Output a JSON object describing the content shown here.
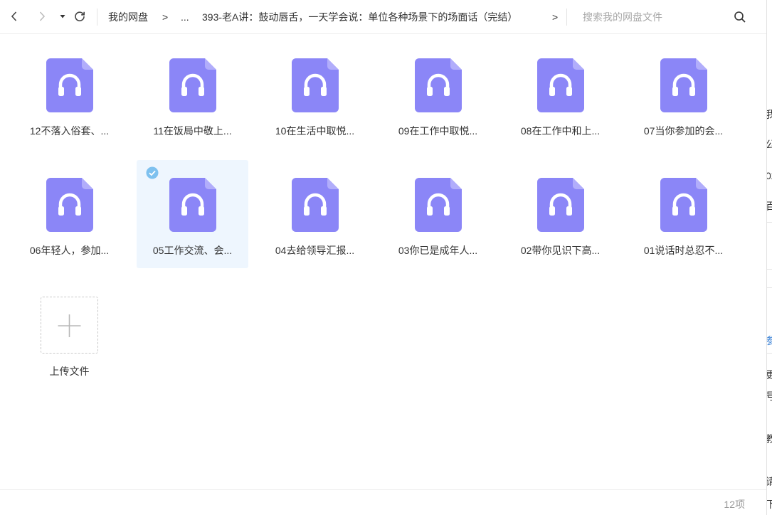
{
  "toolbar": {
    "back_icon": "chevron-left-icon",
    "forward_icon": "chevron-right-icon",
    "history_icon": "caret-down-icon",
    "refresh_icon": "refresh-icon"
  },
  "breadcrumb": {
    "root": "我的网盘",
    "ellipsis": "...",
    "current": "393-老A讲：鼓动唇舌，一天学会说：单位各种场景下的场面话（完结）",
    "separator": ">"
  },
  "search": {
    "placeholder": "搜索我的网盘文件",
    "icon": "search-icon"
  },
  "files": [
    {
      "name": "12不落入俗套、...",
      "icon": "audio-file-icon",
      "selected": false
    },
    {
      "name": "11在饭局中敬上...",
      "icon": "audio-file-icon",
      "selected": false
    },
    {
      "name": "10在生活中取悦...",
      "icon": "audio-file-icon",
      "selected": false
    },
    {
      "name": "09在工作中取悦...",
      "icon": "audio-file-icon",
      "selected": false
    },
    {
      "name": "08在工作中和上...",
      "icon": "audio-file-icon",
      "selected": false
    },
    {
      "name": "07当你参加的会...",
      "icon": "audio-file-icon",
      "selected": false
    },
    {
      "name": "06年轻人，参加...",
      "icon": "audio-file-icon",
      "selected": false
    },
    {
      "name": "05工作交流、会...",
      "icon": "audio-file-icon",
      "selected": true
    },
    {
      "name": "04去给领导汇报...",
      "icon": "audio-file-icon",
      "selected": false
    },
    {
      "name": "03你已是成年人...",
      "icon": "audio-file-icon",
      "selected": false
    },
    {
      "name": "02带你见识下高...",
      "icon": "audio-file-icon",
      "selected": false
    },
    {
      "name": "01说话时总忍不...",
      "icon": "audio-file-icon",
      "selected": false
    }
  ],
  "upload": {
    "label": "上传文件",
    "icon": "plus-icon"
  },
  "status": {
    "count": "12项"
  },
  "colors": {
    "file_icon": "#8b86f7",
    "file_icon_fold": "#b1adfb",
    "selected_bg": "#eef6fe",
    "check": "#7ec1ef"
  }
}
